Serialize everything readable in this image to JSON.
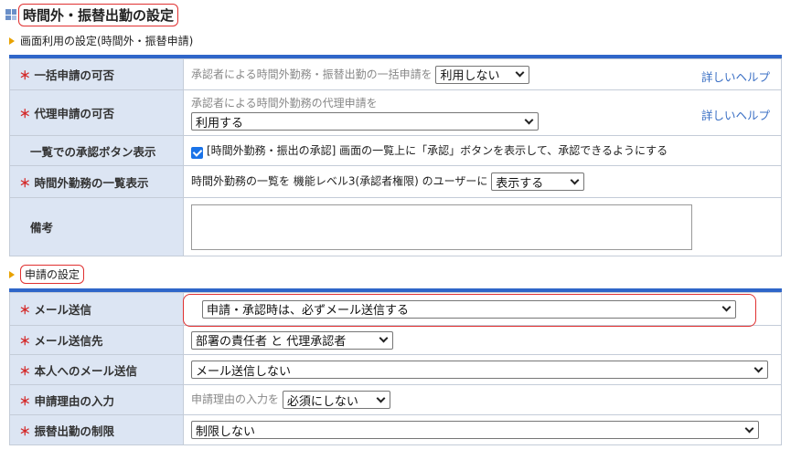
{
  "page": {
    "title": "時間外・振替出勤の設定"
  },
  "section1": {
    "heading": "画面利用の設定(時間外・振替申請)",
    "help_label": "詳しいヘルプ",
    "rows": {
      "bulk": {
        "label": "一括申請の可否",
        "text": "承認者による時間外勤務・振替出勤の一括申請を",
        "select": "利用しない"
      },
      "proxy": {
        "label": "代理申請の可否",
        "text": "承認者による時間外勤務の代理申請を",
        "select": "利用する"
      },
      "approve_btn": {
        "label": "一覧での承認ボタン表示",
        "checkbox_text": "[時間外勤務・振出の承認] 画面の一覧上に「承認」ボタンを表示して、承認できるようにする",
        "checked": true
      },
      "list_display": {
        "label": "時間外勤務の一覧表示",
        "text": "時間外勤務の一覧を 機能レベル3(承認者権限) のユーザーに",
        "select": "表示する"
      },
      "remarks": {
        "label": "備考",
        "value": ""
      }
    }
  },
  "section2": {
    "heading": "申請の設定",
    "rows": {
      "mail": {
        "label": "メール送信",
        "select": "申請・承認時は、必ずメール送信する"
      },
      "mail_to": {
        "label": "メール送信先",
        "select": "部署の責任者 と 代理承認者"
      },
      "self_mail": {
        "label": "本人へのメール送信",
        "select": "メール送信しない"
      },
      "reason": {
        "label": "申請理由の入力",
        "text": "申請理由の入力を",
        "select": "必須にしない"
      },
      "transfer_limit": {
        "label": "振替出勤の制限",
        "select": "制限しない"
      }
    }
  },
  "required_mark": "＊",
  "colors": {
    "accent": "#2f66c9",
    "label_bg": "#dce5f3",
    "required": "#d42a2a",
    "highlight": "#e03030",
    "link": "#3a6fc4"
  }
}
